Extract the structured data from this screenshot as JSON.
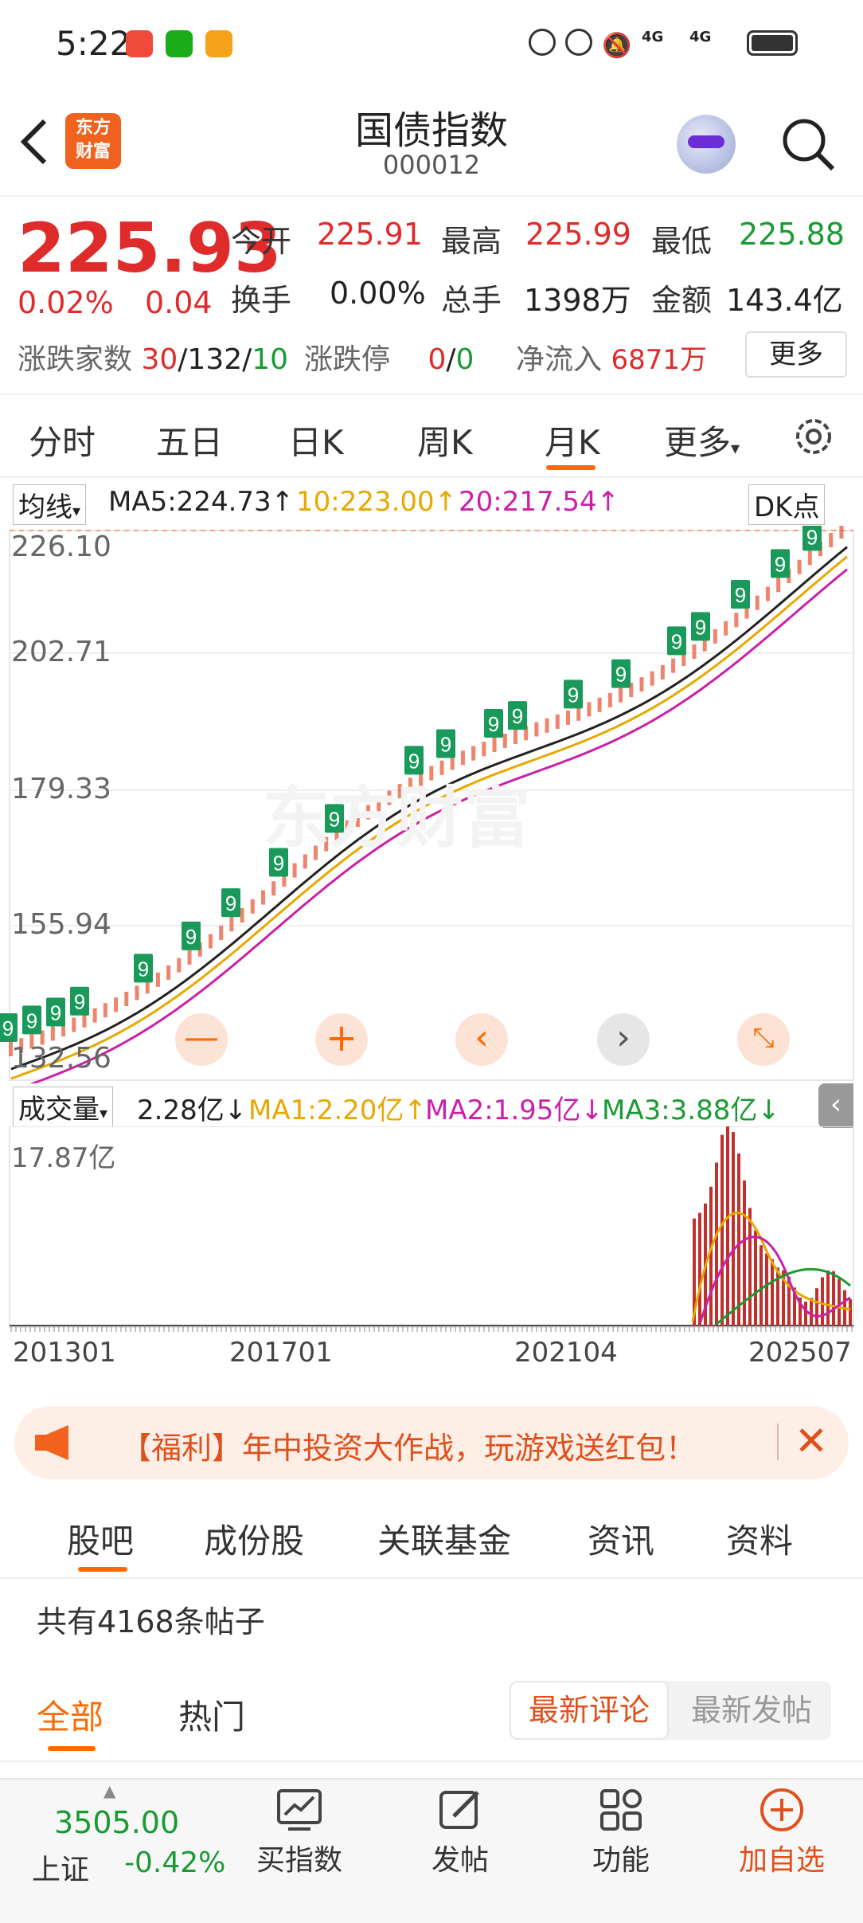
{
  "status": {
    "time": "5:22",
    "signal1": "4G",
    "signal2": "4G"
  },
  "header": {
    "title": "国债指数",
    "code": "000012",
    "logo_line1": "东方",
    "logo_line2": "财富"
  },
  "quote": {
    "price": "225.93",
    "pct": "0.02%",
    "chg": "0.04",
    "open_label": "今开",
    "open": "225.91",
    "high_label": "最高",
    "high": "225.99",
    "low_label": "最低",
    "low": "225.88",
    "turnover_label": "换手",
    "turnover": "0.00%",
    "volume_label": "总手",
    "volume": "1398万",
    "amount_label": "金额",
    "amount": "143.4亿",
    "adv_label": "涨跌家数",
    "adv_up": "30",
    "adv_flat": "132",
    "adv_down": "10",
    "sep": "/",
    "limit_label": "涨跌停",
    "limit_up": "0",
    "limit_down": "0",
    "inflow_label": "净流入",
    "inflow": "6871万",
    "more_label": "更多"
  },
  "ktabs": [
    {
      "label": "分时"
    },
    {
      "label": "五日"
    },
    {
      "label": "日K"
    },
    {
      "label": "周K"
    },
    {
      "label": "月K",
      "active": true
    },
    {
      "label": "更多"
    }
  ],
  "ma": {
    "selector": "均线",
    "ma5": "MA5:224.73↑",
    "ma10": "10:223.00↑",
    "ma20": "20:217.54↑",
    "dk": "DK点"
  },
  "kchart": {
    "y_labels": [
      "226.10",
      "202.71",
      "179.33",
      "155.94",
      "132.56"
    ],
    "watermark": "东方财富",
    "controls": [
      "minus",
      "plus",
      "left",
      "right",
      "expand"
    ]
  },
  "vol": {
    "selector": "成交量",
    "value": "2.28亿↓",
    "ma1": "MA1:2.20亿↑",
    "ma2": "MA2:1.95亿↓",
    "ma3": "MA3:3.88亿↓",
    "max": "17.87亿"
  },
  "x_labels": [
    "201301",
    "201701",
    "202104",
    "202507"
  ],
  "banner": {
    "text": "【福利】年中投资大作战，玩游戏送红包！"
  },
  "subtabs": [
    {
      "label": "股吧",
      "active": true
    },
    {
      "label": "成份股"
    },
    {
      "label": "关联基金"
    },
    {
      "label": "资讯"
    },
    {
      "label": "资料"
    }
  ],
  "posts": {
    "count_text": "共有4168条帖子"
  },
  "filter": {
    "all": "全部",
    "hot": "热门",
    "latest_comment": "最新评论",
    "latest_post": "最新发帖"
  },
  "bottom": {
    "index_value": "3505.00",
    "index_name": "上证",
    "index_pct": "-0.42%",
    "buy": "买指数",
    "post": "发帖",
    "func": "功能",
    "add": "加自选"
  },
  "colors": {
    "up": "#e02b2b",
    "down": "#1a9a32",
    "accent": "#ff6a00",
    "ma10": "#e8a800",
    "ma20": "#cc1fa8"
  }
}
